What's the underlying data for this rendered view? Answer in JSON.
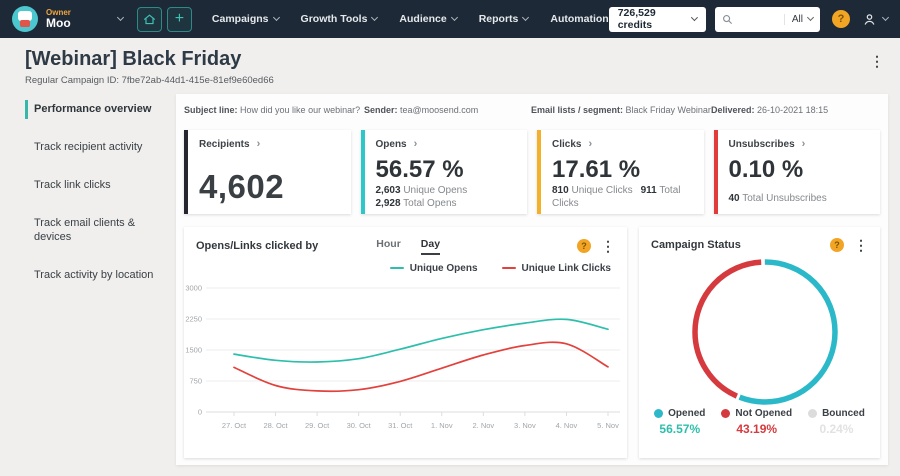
{
  "theme": {
    "accent_teal": "#35b8ab"
  },
  "icons": {
    "chevron_right": "›",
    "kebab": "⋮",
    "help": "?",
    "plus": "+"
  },
  "navbar": {
    "owner_label": "Owner",
    "account_name": "Moo",
    "nav_items": [
      {
        "label": "Campaigns"
      },
      {
        "label": "Growth Tools"
      },
      {
        "label": "Audience"
      },
      {
        "label": "Reports"
      },
      {
        "label": "Automation"
      }
    ],
    "credits_label": "726,529 credits",
    "search_filter": "All"
  },
  "header": {
    "title": "[Webinar] Black Friday",
    "subtitle": "Regular Campaign ID: 7fbe72ab-44d1-415e-81ef9e60ed66"
  },
  "sidebar": {
    "items": [
      {
        "label": "Performance overview",
        "active": true
      },
      {
        "label": "Track recipient activity"
      },
      {
        "label": "Track link clicks"
      },
      {
        "label": "Track email clients & devices"
      },
      {
        "label": "Track activity by location"
      }
    ]
  },
  "info_bar": {
    "items": [
      {
        "label": "Subject line:",
        "value": "How did you like our webinar?"
      },
      {
        "label": "Sender:",
        "value": "tea@moosend.com"
      },
      {
        "label": "Email lists / segment:",
        "value": "Black Friday Webinar"
      },
      {
        "label": "Delivered:",
        "value": "26-10-2021 18:15"
      }
    ]
  },
  "metrics": {
    "cards": [
      {
        "title": "Recipients",
        "value": "4,602",
        "accent": "#26262e"
      },
      {
        "title": "Opens",
        "value": "56.57 %",
        "accent": "#2ec6c8",
        "detail1_num": "2,603",
        "detail1_text": "Unique Opens",
        "detail2_num": "2,928",
        "detail2_text": "Total Opens"
      },
      {
        "title": "Clicks",
        "value": "17.61 %",
        "accent": "#f2b02c",
        "detail1_num": "810",
        "detail1_text": "Unique Clicks",
        "detail2_num": "911",
        "detail2_text": "Total Clicks"
      },
      {
        "title": "Unsubscribes",
        "value": "0.10 %",
        "accent": "#e13b3c",
        "detail1_num": "40",
        "detail1_text": "Total Unsubscribes"
      }
    ]
  },
  "chart_data": [
    {
      "type": "line",
      "title": "Opens/Links clicked by",
      "toggle_options": [
        "Hour",
        "Day"
      ],
      "active_toggle": "Day",
      "x": [
        "27. Oct",
        "28. Oct",
        "29. Oct",
        "30. Oct",
        "31. Oct",
        "1. Nov",
        "2. Nov",
        "3. Nov",
        "4. Nov",
        "5. Nov"
      ],
      "series": [
        {
          "name": "Unique Opens",
          "color": "#2dbfab",
          "values": [
            1400,
            1250,
            1210,
            1290,
            1520,
            1780,
            1990,
            2150,
            2240,
            2000
          ]
        },
        {
          "name": "Unique Link Clicks",
          "color": "#e2413c",
          "values": [
            1080,
            640,
            510,
            540,
            740,
            1060,
            1380,
            1610,
            1650,
            1090
          ]
        }
      ],
      "ylim": [
        0,
        3000
      ],
      "yticks": [
        0,
        750,
        1500,
        2250,
        3000
      ],
      "grid": true,
      "legend_position": "top-right"
    },
    {
      "type": "pie",
      "title": "Campaign Status",
      "slices": [
        {
          "label": "Opened",
          "value": 56.57,
          "display": "56.57%",
          "color": "#2bb8c9",
          "pct_color": "#2dbfab"
        },
        {
          "label": "Not Opened",
          "value": 43.19,
          "display": "43.19%",
          "color": "#d53a3e",
          "pct_color": "#d53a3e"
        },
        {
          "label": "Bounced",
          "value": 0.24,
          "display": "0.24%",
          "color": "#dcdcdc",
          "pct_color": "#e2e2e2"
        }
      ],
      "legend_position": "bottom"
    }
  ]
}
